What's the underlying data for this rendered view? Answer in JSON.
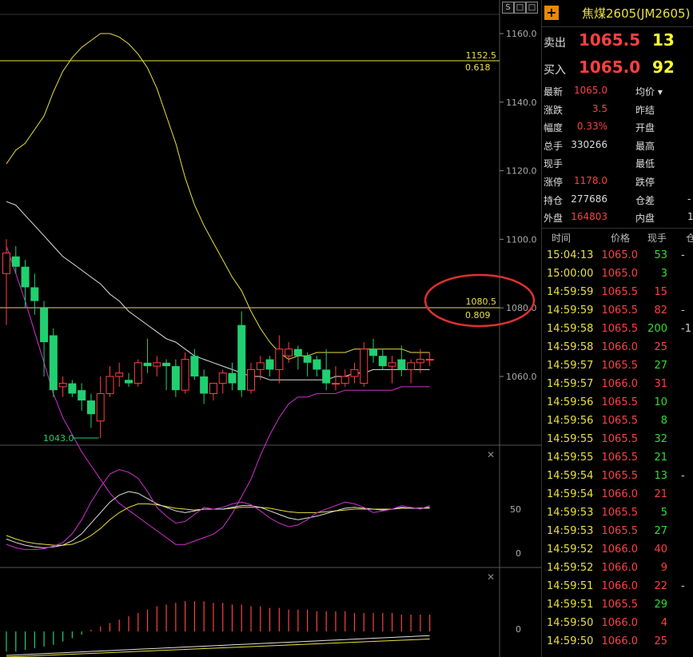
{
  "toolbar": {
    "btn1": "S",
    "btn2": "□",
    "btn3": "□"
  },
  "axis": {
    "main_ticks": [
      "1160.0",
      "1140.0",
      "1120.0",
      "1100.0",
      "1080.0",
      "1060.0"
    ],
    "osc_ticks": [
      "50",
      "0"
    ],
    "macd_ticks": [
      "0"
    ]
  },
  "annotations": {
    "fib1_price": "1152.5",
    "fib1_ratio": "0.618",
    "fib2_price": "1080.5",
    "fib2_ratio": "0.809",
    "low_label": "1043.0"
  },
  "colors": {
    "up": "#ff4040",
    "down": "#20d070",
    "yellow": "#e8e040",
    "magenta": "#d030d0"
  },
  "chart_data": {
    "type": "candlestick",
    "ohlc": [
      [
        1090,
        1100,
        1075,
        1096
      ],
      [
        1095,
        1098,
        1090,
        1092
      ],
      [
        1092,
        1094,
        1080,
        1086
      ],
      [
        1086,
        1090,
        1078,
        1082
      ],
      [
        1080,
        1082,
        1060,
        1070
      ],
      [
        1072,
        1074,
        1054,
        1056
      ],
      [
        1057,
        1060,
        1054,
        1058
      ],
      [
        1058,
        1059,
        1054,
        1055
      ],
      [
        1056,
        1058,
        1050,
        1053
      ],
      [
        1053,
        1055,
        1045,
        1049
      ],
      [
        1047,
        1060,
        1043,
        1055
      ],
      [
        1055,
        1063,
        1054,
        1060
      ],
      [
        1060,
        1064,
        1057,
        1061
      ],
      [
        1059,
        1061,
        1057,
        1058
      ],
      [
        1058,
        1065,
        1057,
        1064
      ],
      [
        1064,
        1071,
        1061,
        1063
      ],
      [
        1063,
        1066,
        1060,
        1064
      ],
      [
        1064,
        1065,
        1056,
        1063
      ],
      [
        1063,
        1065,
        1054,
        1056
      ],
      [
        1056,
        1067,
        1055,
        1065
      ],
      [
        1066,
        1068,
        1059,
        1060
      ],
      [
        1060,
        1062,
        1052,
        1055
      ],
      [
        1055,
        1058,
        1053,
        1058
      ],
      [
        1058,
        1062,
        1055,
        1061
      ],
      [
        1061,
        1064,
        1056,
        1058
      ],
      [
        1075,
        1079,
        1054,
        1056
      ],
      [
        1056,
        1064,
        1055,
        1062
      ],
      [
        1062,
        1066,
        1059,
        1064
      ],
      [
        1065,
        1066,
        1060,
        1062
      ],
      [
        1062,
        1072,
        1058,
        1068
      ],
      [
        1066,
        1070,
        1064,
        1068
      ],
      [
        1068,
        1069,
        1062,
        1066
      ],
      [
        1066,
        1067,
        1060,
        1064
      ],
      [
        1065,
        1066,
        1060,
        1062
      ],
      [
        1062,
        1068,
        1056,
        1058
      ],
      [
        1058,
        1063,
        1056,
        1058
      ],
      [
        1058,
        1062,
        1057,
        1060
      ],
      [
        1060,
        1064,
        1058,
        1062
      ],
      [
        1058,
        1070,
        1057,
        1068
      ],
      [
        1068,
        1071,
        1064,
        1066
      ],
      [
        1066,
        1068,
        1062,
        1063
      ],
      [
        1063,
        1066,
        1058,
        1064
      ],
      [
        1065,
        1069,
        1060,
        1062
      ],
      [
        1062,
        1065,
        1058,
        1064
      ],
      [
        1064,
        1068,
        1061,
        1065
      ],
      [
        1065,
        1067,
        1063,
        1065
      ]
    ],
    "upper_band": [
      1122,
      1126,
      1128,
      1132,
      1136,
      1143,
      1149,
      1153,
      1156,
      1158,
      1160,
      1160,
      1159,
      1157,
      1154,
      1150,
      1144,
      1136,
      1128,
      1118,
      1110,
      1104,
      1099,
      1094,
      1089,
      1085,
      1079,
      1074,
      1070,
      1067,
      1065,
      1066,
      1066,
      1067,
      1067,
      1067,
      1067,
      1068,
      1068,
      1068,
      1068,
      1068,
      1068,
      1067,
      1067,
      1067
    ],
    "middle_band": [
      1111,
      1110,
      1107,
      1104,
      1101,
      1098,
      1095,
      1093,
      1091,
      1089,
      1087,
      1084,
      1082,
      1079,
      1077,
      1075,
      1073,
      1071,
      1070,
      1068,
      1066,
      1065,
      1064,
      1063,
      1062,
      1061,
      1060,
      1060,
      1059,
      1059,
      1059,
      1059,
      1059,
      1059,
      1059,
      1060,
      1060,
      1061,
      1061,
      1062,
      1062,
      1062,
      1062,
      1062,
      1062,
      1062
    ],
    "lower_band": [
      1098,
      1090,
      1082,
      1073,
      1064,
      1055,
      1048,
      1043,
      1038,
      1034,
      1030,
      1026,
      1023,
      1021,
      1019,
      1017,
      1015,
      1013,
      1011,
      1011,
      1012,
      1013,
      1014,
      1016,
      1020,
      1025,
      1030,
      1037,
      1043,
      1048,
      1052,
      1054,
      1054,
      1055,
      1055,
      1055,
      1056,
      1056,
      1056,
      1056,
      1056,
      1056,
      1057,
      1057,
      1057,
      1057
    ],
    "osc_k": [
      10,
      6,
      4,
      4,
      5,
      8,
      12,
      22,
      38,
      58,
      75,
      90,
      95,
      92,
      85,
      70,
      52,
      42,
      34,
      36,
      44,
      52,
      50,
      52,
      56,
      58,
      55,
      48,
      40,
      34,
      30,
      32,
      38,
      46,
      50,
      54,
      58,
      56,
      52,
      46,
      48,
      50,
      54,
      52,
      50,
      54
    ],
    "osc_d": [
      16,
      12,
      9,
      7,
      6,
      7,
      9,
      14,
      22,
      34,
      46,
      58,
      66,
      70,
      68,
      62,
      56,
      52,
      48,
      46,
      48,
      50,
      50,
      50,
      52,
      54,
      54,
      52,
      48,
      44,
      40,
      38,
      40,
      42,
      45,
      48,
      51,
      52,
      51,
      50,
      49,
      50,
      52,
      51,
      51,
      52
    ],
    "osc_j": [
      20,
      16,
      13,
      11,
      10,
      9,
      9,
      10,
      14,
      20,
      28,
      38,
      46,
      52,
      56,
      56,
      55,
      53,
      51,
      50,
      49,
      50,
      50,
      50,
      51,
      52,
      52,
      52,
      51,
      49,
      47,
      46,
      46,
      46,
      47,
      48,
      49,
      50,
      50,
      50,
      50,
      50,
      51,
      51,
      51,
      51
    ],
    "macd_hist": [
      -12,
      -12,
      -11,
      -10,
      -9,
      -8,
      -6,
      -4,
      -2,
      1,
      3,
      5,
      7,
      9,
      11,
      13,
      15,
      16,
      17,
      18,
      18,
      18,
      17,
      17,
      16,
      16,
      15,
      15,
      14,
      14,
      13,
      13,
      13,
      12,
      12,
      12,
      12,
      11,
      11,
      11,
      11,
      11,
      10,
      10,
      10,
      10
    ]
  },
  "quote": {
    "title": "焦煤2605(JM2605)",
    "ask_label": "卖出",
    "ask_price": "1065.5",
    "ask_vol": "13",
    "bid_label": "买入",
    "bid_price": "1065.0",
    "bid_vol": "92",
    "stats": [
      {
        "l": "最新",
        "v": "1065.0",
        "vc": "red",
        "l2": "均价 ▾",
        "v2": ""
      },
      {
        "l": "涨跌",
        "v": "3.5",
        "vc": "red",
        "l2": "昨结",
        "v2": ""
      },
      {
        "l": "幅度",
        "v": "0.33%",
        "vc": "red",
        "l2": "开盘",
        "v2": ""
      },
      {
        "l": "总手",
        "v": "330266",
        "vc": "white",
        "l2": "最高",
        "v2": ""
      },
      {
        "l": "现手",
        "v": "",
        "vc": "white",
        "l2": "最低",
        "v2": ""
      },
      {
        "l": "涨停",
        "v": "1178.0",
        "vc": "red",
        "l2": "跌停",
        "v2": ""
      },
      {
        "l": "持仓",
        "v": "277686",
        "vc": "white",
        "l2": "仓差",
        "v2": "-"
      },
      {
        "l": "外盘",
        "v": "164803",
        "vc": "red",
        "l2": "内盘",
        "v2": "1"
      }
    ],
    "tick_headers": {
      "time": "时间",
      "price": "价格",
      "vol": "现手",
      "extra": "仓"
    },
    "ticks": [
      {
        "t": "15:04:13",
        "p": "1065.0",
        "pc": "up",
        "v": "53",
        "vc": "volg",
        "x": "-"
      },
      {
        "t": "15:00:00",
        "p": "1065.0",
        "pc": "up",
        "v": "3",
        "vc": "volg",
        "x": ""
      },
      {
        "t": "14:59:59",
        "p": "1065.5",
        "pc": "up",
        "v": "15",
        "vc": "up",
        "x": ""
      },
      {
        "t": "14:59:59",
        "p": "1065.5",
        "pc": "up",
        "v": "82",
        "vc": "up",
        "x": "-"
      },
      {
        "t": "14:59:58",
        "p": "1065.5",
        "pc": "up",
        "v": "200",
        "vc": "volg",
        "x": "-1"
      },
      {
        "t": "14:59:58",
        "p": "1066.0",
        "pc": "up",
        "v": "25",
        "vc": "up",
        "x": ""
      },
      {
        "t": "14:59:57",
        "p": "1065.5",
        "pc": "up",
        "v": "27",
        "vc": "volg",
        "x": ""
      },
      {
        "t": "14:59:57",
        "p": "1066.0",
        "pc": "up",
        "v": "31",
        "vc": "up",
        "x": ""
      },
      {
        "t": "14:59:56",
        "p": "1065.5",
        "pc": "up",
        "v": "10",
        "vc": "volg",
        "x": ""
      },
      {
        "t": "14:59:56",
        "p": "1065.5",
        "pc": "up",
        "v": "8",
        "vc": "volg",
        "x": ""
      },
      {
        "t": "14:59:55",
        "p": "1065.5",
        "pc": "up",
        "v": "32",
        "vc": "volg",
        "x": ""
      },
      {
        "t": "14:59:55",
        "p": "1065.5",
        "pc": "up",
        "v": "21",
        "vc": "volg",
        "x": ""
      },
      {
        "t": "14:59:54",
        "p": "1065.5",
        "pc": "up",
        "v": "13",
        "vc": "volg",
        "x": "-"
      },
      {
        "t": "14:59:54",
        "p": "1066.0",
        "pc": "up",
        "v": "21",
        "vc": "up",
        "x": ""
      },
      {
        "t": "14:59:53",
        "p": "1065.5",
        "pc": "up",
        "v": "5",
        "vc": "volg",
        "x": ""
      },
      {
        "t": "14:59:53",
        "p": "1065.5",
        "pc": "up",
        "v": "27",
        "vc": "volg",
        "x": ""
      },
      {
        "t": "14:59:52",
        "p": "1066.0",
        "pc": "up",
        "v": "40",
        "vc": "up",
        "x": ""
      },
      {
        "t": "14:59:52",
        "p": "1066.0",
        "pc": "up",
        "v": "9",
        "vc": "up",
        "x": ""
      },
      {
        "t": "14:59:51",
        "p": "1066.0",
        "pc": "up",
        "v": "22",
        "vc": "up",
        "x": "-"
      },
      {
        "t": "14:59:51",
        "p": "1065.5",
        "pc": "up",
        "v": "29",
        "vc": "volg",
        "x": ""
      },
      {
        "t": "14:59:50",
        "p": "1066.0",
        "pc": "up",
        "v": "4",
        "vc": "up",
        "x": ""
      },
      {
        "t": "14:59:50",
        "p": "1066.0",
        "pc": "up",
        "v": "25",
        "vc": "up",
        "x": ""
      }
    ]
  }
}
